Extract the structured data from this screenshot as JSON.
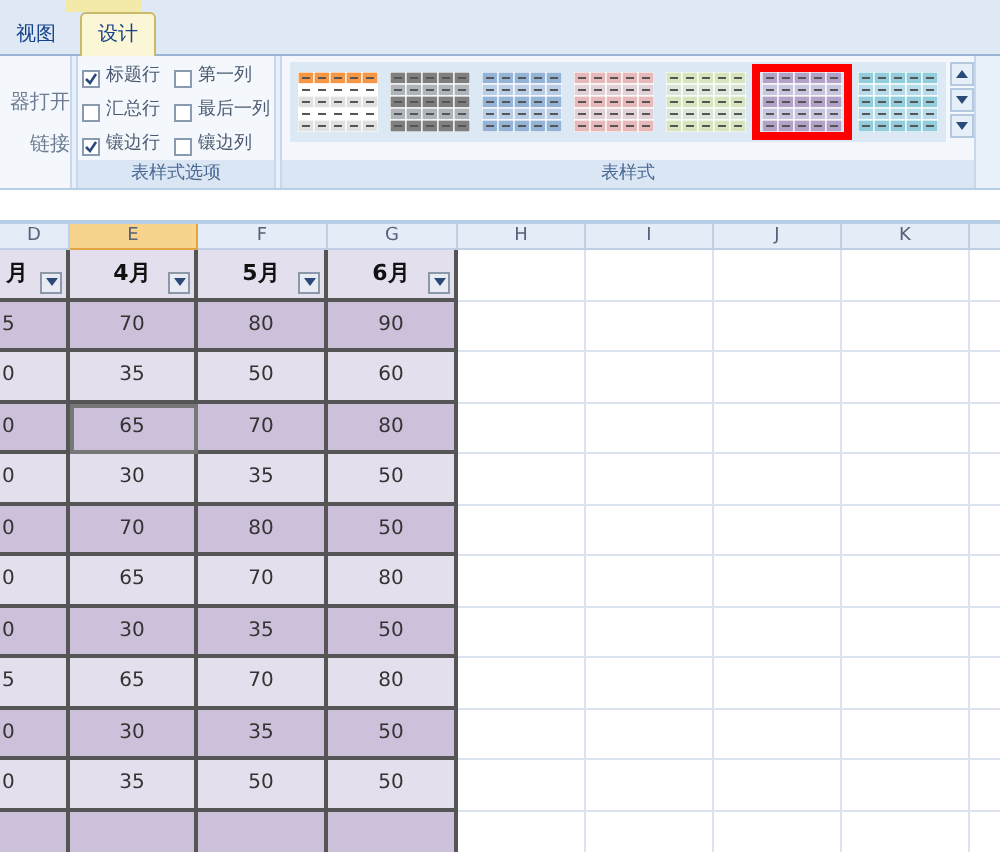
{
  "tabs": [
    {
      "label": "视图",
      "selected": false
    },
    {
      "label": "设计",
      "selected": true
    }
  ],
  "left_group": {
    "items": [
      "器打开",
      "链接"
    ]
  },
  "options_group": {
    "label": "表样式选项",
    "options": [
      {
        "label": "标题行",
        "checked": true
      },
      {
        "label": "汇总行",
        "checked": false
      },
      {
        "label": "镶边行",
        "checked": true
      },
      {
        "label": "第一列",
        "checked": false
      },
      {
        "label": "最后一列",
        "checked": false
      },
      {
        "label": "镶边列",
        "checked": false
      }
    ]
  },
  "styles_group": {
    "label": "表样式",
    "styles": [
      {
        "color": "#f79646",
        "selected": false
      },
      {
        "color": "#7f7f7f",
        "selected": false
      },
      {
        "color": "#95b3d7",
        "selected": false
      },
      {
        "color": "#e6b8b7",
        "selected": false
      },
      {
        "color": "#d7e4bd",
        "selected": false
      },
      {
        "color": "#b3a2c7",
        "selected": true
      },
      {
        "color": "#92cddc",
        "selected": false
      }
    ]
  },
  "sheet": {
    "columns": [
      {
        "label": "D",
        "selected": false
      },
      {
        "label": "E",
        "selected": true
      },
      {
        "label": "F",
        "selected": false
      },
      {
        "label": "G",
        "selected": false
      },
      {
        "label": "H",
        "selected": false
      },
      {
        "label": "I",
        "selected": false
      },
      {
        "label": "J",
        "selected": false
      },
      {
        "label": "K",
        "selected": false
      }
    ],
    "headers": [
      "月",
      "4月",
      "5月",
      "6月"
    ],
    "rows": [
      {
        "cells": [
          "5",
          "70",
          "80",
          "90"
        ]
      },
      {
        "cells": [
          "0",
          "35",
          "50",
          "60"
        ]
      },
      {
        "cells": [
          "0",
          "65",
          "70",
          "80"
        ],
        "selected": [
          false,
          true,
          false,
          false
        ]
      },
      {
        "cells": [
          "0",
          "30",
          "35",
          "50"
        ]
      },
      {
        "cells": [
          "0",
          "70",
          "80",
          "50"
        ]
      },
      {
        "cells": [
          "0",
          "65",
          "70",
          "80"
        ]
      },
      {
        "cells": [
          "0",
          "30",
          "35",
          "50"
        ]
      },
      {
        "cells": [
          "5",
          "65",
          "70",
          "80"
        ]
      },
      {
        "cells": [
          "0",
          "30",
          "35",
          "50"
        ]
      },
      {
        "cells": [
          "0",
          "35",
          "50",
          "50"
        ]
      },
      {
        "cells": [
          "",
          "",
          "",
          ""
        ]
      }
    ]
  }
}
